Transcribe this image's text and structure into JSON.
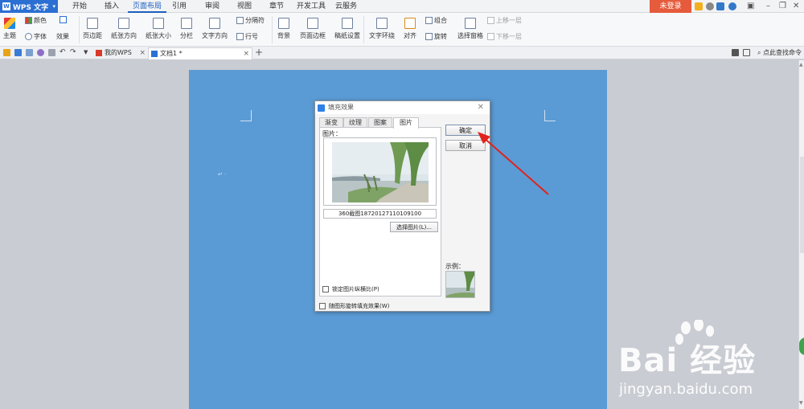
{
  "app": {
    "name": "WPS 文字",
    "login": "未登录"
  },
  "menu_tabs": [
    "开始",
    "插入",
    "页面布局",
    "引用",
    "审阅",
    "视图",
    "章节",
    "开发工具",
    "云服务"
  ],
  "menu_active": "页面布局",
  "ribbon": {
    "theme": "主题",
    "color": "颜色",
    "font": "字体",
    "effect": "效果",
    "margin": "页边距",
    "orientation": "纸张方向",
    "size": "纸张大小",
    "columns": "分栏",
    "text_direction": "文字方向",
    "separator": "分隔符",
    "line_number": "行号",
    "background": "背景",
    "page_border": "页面边框",
    "manuscript": "稿纸设置",
    "wrap": "文字环绕",
    "align": "对齐",
    "group": "组合",
    "rotate": "旋转",
    "selection_pane": "选择窗格",
    "bring_forward": "上移一层",
    "send_backward": "下移一层"
  },
  "doc_tabs": [
    "我的WPS",
    "文档1 *"
  ],
  "command_search": "点此查找命令",
  "dialog": {
    "title": "填充效果",
    "tabs": [
      "渐变",
      "纹理",
      "图案",
      "图片"
    ],
    "active_tab": "图片",
    "picture_label": "图片：",
    "filename": "360截图18720127110109100",
    "select_button": "选择图片(L)...",
    "lock_ratio": "锁定图片纵横比(P)",
    "rotate_with_shape": "随图形旋转填充效果(W)",
    "ok": "确定",
    "cancel": "取消",
    "sample_label": "示例："
  },
  "watermark": {
    "brand": "Bai 经验",
    "url": "jingyan.baidu.com"
  },
  "colors": {
    "accent": "#2b6fd2",
    "page": "#5b9bd5",
    "login": "#e55b3c",
    "arrow": "#e0231c"
  }
}
